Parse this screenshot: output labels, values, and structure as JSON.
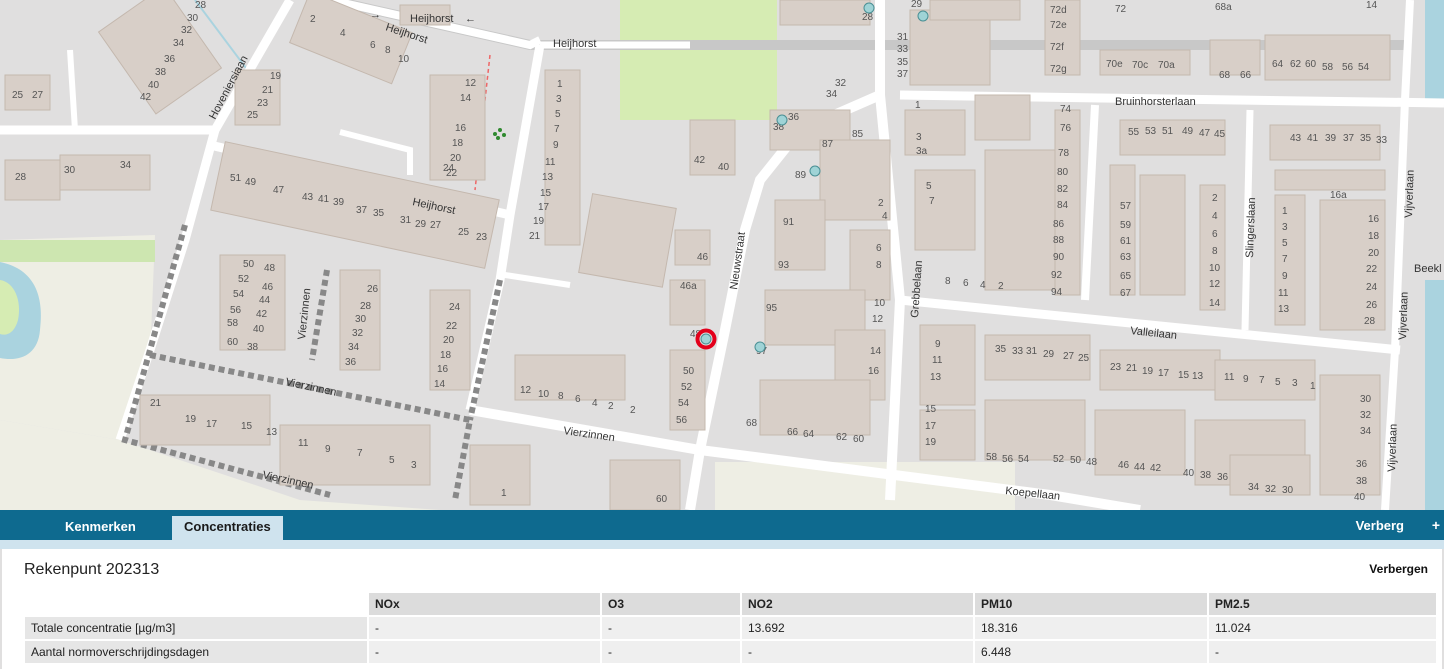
{
  "map": {
    "streets": [
      "Heijhorst",
      "Heijhorst",
      "Heijhorst",
      "Hoveniersiaan",
      "Nieuwstraat",
      "Vierzinnen",
      "Vierzinnen",
      "Vierzinnen",
      "Vierzinnen",
      "Koepellaan",
      "Grebbelaan",
      "Valleilaan",
      "Bruinhorsterlaan",
      "Slingerslaan",
      "Vijverlaan",
      "Vijverlaan",
      "Vijverlaan",
      "Beekl"
    ],
    "house_numbers": [
      "2",
      "4",
      "6",
      "8",
      "10",
      "12",
      "14",
      "16",
      "18",
      "20",
      "22",
      "24",
      "19",
      "21",
      "23",
      "25",
      "25",
      "27",
      "28",
      "30",
      "32",
      "34",
      "36",
      "38",
      "40",
      "42",
      "28",
      "30",
      "34",
      "51",
      "49",
      "47",
      "43",
      "41",
      "39",
      "37",
      "35",
      "31",
      "29",
      "27",
      "25",
      "23",
      "50",
      "48",
      "52",
      "46",
      "54",
      "44",
      "56",
      "42",
      "58",
      "40",
      "60",
      "38",
      "26",
      "28",
      "30",
      "32",
      "34",
      "36",
      "24",
      "22",
      "20",
      "18",
      "16",
      "14",
      "1",
      "3",
      "5",
      "7",
      "9",
      "11",
      "13",
      "15",
      "17",
      "19",
      "21",
      "42",
      "40",
      "46",
      "46a",
      "48",
      "50",
      "52",
      "54",
      "56",
      "12",
      "10",
      "8",
      "6",
      "4",
      "2",
      "21",
      "19",
      "17",
      "15",
      "13",
      "11",
      "9",
      "7",
      "5",
      "3",
      "1",
      "60",
      "32",
      "34",
      "36",
      "38",
      "85",
      "87",
      "89",
      "91",
      "2",
      "4",
      "6",
      "8",
      "93",
      "95",
      "10",
      "12",
      "14",
      "16",
      "68",
      "66",
      "64",
      "62",
      "60",
      "97",
      "29",
      "28",
      "31",
      "33",
      "35",
      "37",
      "1",
      "3",
      "3a",
      "5",
      "7",
      "8",
      "6",
      "4",
      "2",
      "74",
      "76",
      "78",
      "80",
      "82",
      "84",
      "86",
      "88",
      "90",
      "92",
      "94",
      "72",
      "72d",
      "72e",
      "72f",
      "72g",
      "70e",
      "70c",
      "70a",
      "68a",
      "68",
      "66",
      "64",
      "62",
      "60",
      "58",
      "56",
      "54",
      "14",
      "55",
      "53",
      "51",
      "49",
      "47",
      "45",
      "57",
      "59",
      "61",
      "63",
      "65",
      "67",
      "2",
      "4",
      "6",
      "8",
      "10",
      "12",
      "14",
      "43",
      "41",
      "39",
      "37",
      "35",
      "33",
      "16a",
      "1",
      "3",
      "5",
      "7",
      "9",
      "11",
      "13",
      "16",
      "18",
      "20",
      "22",
      "24",
      "26",
      "28",
      "9",
      "11",
      "13",
      "15",
      "17",
      "19",
      "35",
      "33",
      "31",
      "29",
      "27",
      "25",
      "23",
      "21",
      "19",
      "17",
      "15",
      "13",
      "11",
      "9",
      "7",
      "5",
      "3",
      "1",
      "58",
      "56",
      "54",
      "52",
      "50",
      "48",
      "46",
      "44",
      "42",
      "40",
      "38",
      "36",
      "34",
      "32",
      "30",
      "30",
      "32",
      "36",
      "38",
      "40"
    ]
  },
  "panel": {
    "tabs": [
      {
        "label": "Kenmerken",
        "active": false
      },
      {
        "label": "Concentraties",
        "active": true
      }
    ],
    "hide_label": "Verberg",
    "plus_label": "+",
    "title": "Rekenpunt 202313",
    "close_label": "Verbergen",
    "table": {
      "columns": [
        "NOx",
        "O3",
        "NO2",
        "PM10",
        "PM2.5"
      ],
      "rows": [
        {
          "label": "Totale concentratie [µg/m3]",
          "values": [
            "-",
            "-",
            "13.692",
            "18.316",
            "11.024"
          ]
        },
        {
          "label": "Aantal normoverschrijdingsdagen",
          "values": [
            "-",
            "-",
            "-",
            "6.448",
            "-"
          ]
        }
      ]
    }
  },
  "colors": {
    "tab_bar": "#0e6a8f",
    "active_tab": "#cfe3ee",
    "marker_ring": "#e3001b",
    "receptor": "#9fd3d6",
    "park": "#d6ecb3",
    "water": "#aad3df"
  }
}
